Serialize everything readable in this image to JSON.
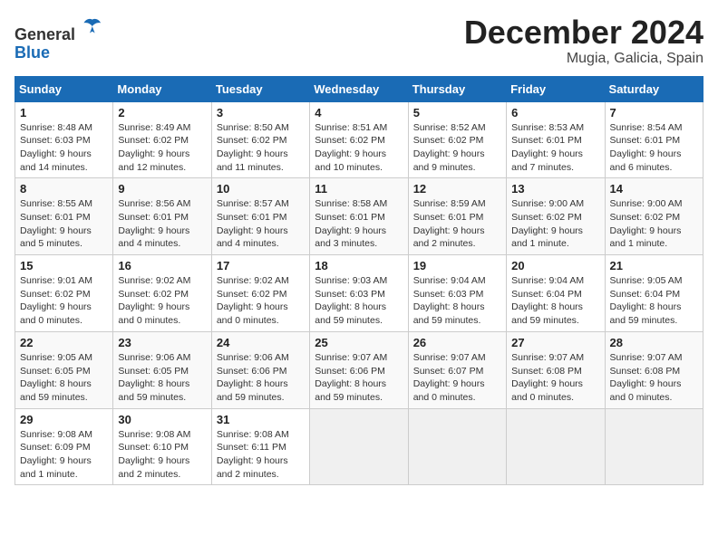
{
  "header": {
    "logo_line1": "General",
    "logo_line2": "Blue",
    "month_title": "December 2024",
    "location": "Mugia, Galicia, Spain"
  },
  "weekdays": [
    "Sunday",
    "Monday",
    "Tuesday",
    "Wednesday",
    "Thursday",
    "Friday",
    "Saturday"
  ],
  "weeks": [
    [
      {
        "day": "1",
        "sunrise": "8:48 AM",
        "sunset": "6:03 PM",
        "daylight": "9 hours and 14 minutes."
      },
      {
        "day": "2",
        "sunrise": "8:49 AM",
        "sunset": "6:02 PM",
        "daylight": "9 hours and 12 minutes."
      },
      {
        "day": "3",
        "sunrise": "8:50 AM",
        "sunset": "6:02 PM",
        "daylight": "9 hours and 11 minutes."
      },
      {
        "day": "4",
        "sunrise": "8:51 AM",
        "sunset": "6:02 PM",
        "daylight": "9 hours and 10 minutes."
      },
      {
        "day": "5",
        "sunrise": "8:52 AM",
        "sunset": "6:02 PM",
        "daylight": "9 hours and 9 minutes."
      },
      {
        "day": "6",
        "sunrise": "8:53 AM",
        "sunset": "6:01 PM",
        "daylight": "9 hours and 7 minutes."
      },
      {
        "day": "7",
        "sunrise": "8:54 AM",
        "sunset": "6:01 PM",
        "daylight": "9 hours and 6 minutes."
      }
    ],
    [
      {
        "day": "8",
        "sunrise": "8:55 AM",
        "sunset": "6:01 PM",
        "daylight": "9 hours and 5 minutes."
      },
      {
        "day": "9",
        "sunrise": "8:56 AM",
        "sunset": "6:01 PM",
        "daylight": "9 hours and 4 minutes."
      },
      {
        "day": "10",
        "sunrise": "8:57 AM",
        "sunset": "6:01 PM",
        "daylight": "9 hours and 4 minutes."
      },
      {
        "day": "11",
        "sunrise": "8:58 AM",
        "sunset": "6:01 PM",
        "daylight": "9 hours and 3 minutes."
      },
      {
        "day": "12",
        "sunrise": "8:59 AM",
        "sunset": "6:01 PM",
        "daylight": "9 hours and 2 minutes."
      },
      {
        "day": "13",
        "sunrise": "9:00 AM",
        "sunset": "6:02 PM",
        "daylight": "9 hours and 1 minute."
      },
      {
        "day": "14",
        "sunrise": "9:00 AM",
        "sunset": "6:02 PM",
        "daylight": "9 hours and 1 minute."
      }
    ],
    [
      {
        "day": "15",
        "sunrise": "9:01 AM",
        "sunset": "6:02 PM",
        "daylight": "9 hours and 0 minutes."
      },
      {
        "day": "16",
        "sunrise": "9:02 AM",
        "sunset": "6:02 PM",
        "daylight": "9 hours and 0 minutes."
      },
      {
        "day": "17",
        "sunrise": "9:02 AM",
        "sunset": "6:02 PM",
        "daylight": "9 hours and 0 minutes."
      },
      {
        "day": "18",
        "sunrise": "9:03 AM",
        "sunset": "6:03 PM",
        "daylight": "8 hours and 59 minutes."
      },
      {
        "day": "19",
        "sunrise": "9:04 AM",
        "sunset": "6:03 PM",
        "daylight": "8 hours and 59 minutes."
      },
      {
        "day": "20",
        "sunrise": "9:04 AM",
        "sunset": "6:04 PM",
        "daylight": "8 hours and 59 minutes."
      },
      {
        "day": "21",
        "sunrise": "9:05 AM",
        "sunset": "6:04 PM",
        "daylight": "8 hours and 59 minutes."
      }
    ],
    [
      {
        "day": "22",
        "sunrise": "9:05 AM",
        "sunset": "6:05 PM",
        "daylight": "8 hours and 59 minutes."
      },
      {
        "day": "23",
        "sunrise": "9:06 AM",
        "sunset": "6:05 PM",
        "daylight": "8 hours and 59 minutes."
      },
      {
        "day": "24",
        "sunrise": "9:06 AM",
        "sunset": "6:06 PM",
        "daylight": "8 hours and 59 minutes."
      },
      {
        "day": "25",
        "sunrise": "9:07 AM",
        "sunset": "6:06 PM",
        "daylight": "8 hours and 59 minutes."
      },
      {
        "day": "26",
        "sunrise": "9:07 AM",
        "sunset": "6:07 PM",
        "daylight": "9 hours and 0 minutes."
      },
      {
        "day": "27",
        "sunrise": "9:07 AM",
        "sunset": "6:08 PM",
        "daylight": "9 hours and 0 minutes."
      },
      {
        "day": "28",
        "sunrise": "9:07 AM",
        "sunset": "6:08 PM",
        "daylight": "9 hours and 0 minutes."
      }
    ],
    [
      {
        "day": "29",
        "sunrise": "9:08 AM",
        "sunset": "6:09 PM",
        "daylight": "9 hours and 1 minute."
      },
      {
        "day": "30",
        "sunrise": "9:08 AM",
        "sunset": "6:10 PM",
        "daylight": "9 hours and 2 minutes."
      },
      {
        "day": "31",
        "sunrise": "9:08 AM",
        "sunset": "6:11 PM",
        "daylight": "9 hours and 2 minutes."
      },
      null,
      null,
      null,
      null
    ]
  ],
  "labels": {
    "sunrise_prefix": "Sunrise: ",
    "sunset_prefix": "Sunset: ",
    "daylight_prefix": "Daylight: "
  }
}
